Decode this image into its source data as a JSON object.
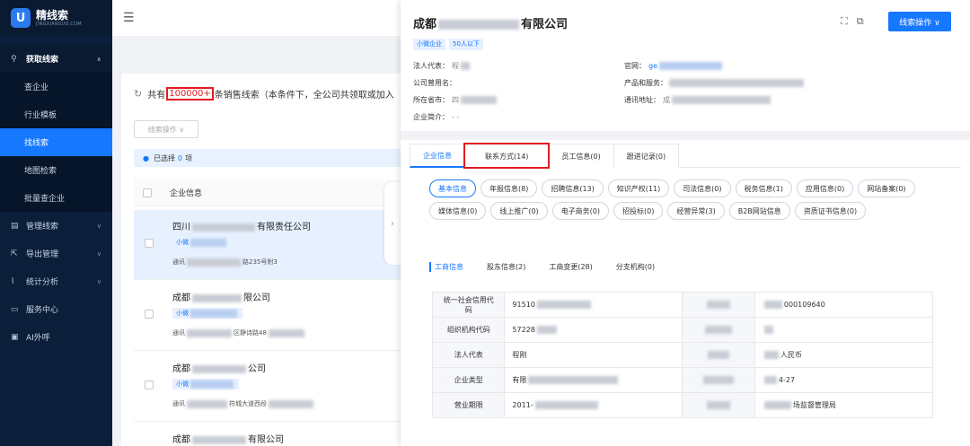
{
  "app": {
    "name": "精线索",
    "sub": "JINGXIANSUO.COM"
  },
  "sidebar": {
    "groups": [
      {
        "label": "获取线索",
        "icon": "search-icon"
      },
      {
        "label": "管理线索",
        "icon": "list-icon"
      },
      {
        "label": "导出管理",
        "icon": "export-icon"
      },
      {
        "label": "统计分析",
        "icon": "chart-icon"
      },
      {
        "label": "服务中心",
        "icon": "service-icon"
      },
      {
        "label": "AI外呼",
        "icon": "phone-icon"
      }
    ],
    "sub_items": [
      "查企业",
      "行业模板",
      "找线索",
      "地图检索",
      "批量查企业"
    ]
  },
  "list": {
    "count_prefix": "共有",
    "count_value": "100000+",
    "count_suffix": "条销售线索（本条件下，全公司共领取或加入",
    "op_button": "线索操作 ∨",
    "selected_prefix": "已选择",
    "selected_count": "0",
    "selected_suffix": "项",
    "column_header": "企业信息",
    "rows": [
      {
        "name_a": "四川",
        "name_b": "有限责任公司",
        "tag": "小微",
        "addr_a": "通讯",
        "addr_b": "路235号附3"
      },
      {
        "name_a": "成都",
        "name_b": "限公司",
        "tag": "小微",
        "addr_a": "通讯",
        "addr_b": "区静诗路48"
      },
      {
        "name_a": "成都",
        "name_b": "公司",
        "tag": "小微",
        "addr_a": "通讯",
        "addr_b": "符城大道西段"
      },
      {
        "name_a": "成都",
        "name_b": "有限公司",
        "tag": "",
        "addr_a": "",
        "addr_b": ""
      }
    ]
  },
  "drawer": {
    "title_a": "成都",
    "title_b": "有限公司",
    "tags": [
      "小微企业",
      "50人以下"
    ],
    "action_button": "线索操作 ∨",
    "fields": {
      "legal_rep": "法人代表：",
      "legal_rep_val": "程",
      "former_name": "公司曾用名：",
      "region": "所在省市：",
      "region_val": "四",
      "intro": "企业简介：",
      "intro_val": "- -",
      "website": "官网：",
      "website_val": "ge",
      "products": "产品和服务：",
      "address": "通讯地址：",
      "address_val": "成"
    },
    "tabs": [
      "企业信息",
      "联系方式(14)",
      "员工信息(0)",
      "跟进记录(0)"
    ],
    "pills": [
      "基本信息",
      "年报信息(8)",
      "招聘信息(13)",
      "知识产权(11)",
      "司法信息(0)",
      "税务信息(1)",
      "应用信息(0)",
      "网站备案(0)",
      "媒体信息(0)",
      "线上推广(0)",
      "电子商务(0)",
      "招投标(0)",
      "经营异常(3)",
      "B2B网站信息",
      "资质证书信息(0)"
    ],
    "subtabs": [
      "工商信息",
      "股东信息(2)",
      "工商变更(28)",
      "分支机构(0)"
    ],
    "table": [
      {
        "label": "统一社会信用代码",
        "value": "91510",
        "value2": "000109640"
      },
      {
        "label": "组织机构代码",
        "value": "57228",
        "value2": ""
      },
      {
        "label": "法人代表",
        "value": "程刚",
        "value2": "人民币"
      },
      {
        "label": "企业类型",
        "value": "有限",
        "value2": "4-27"
      },
      {
        "label": "营业期限",
        "value": "2011-",
        "value2": "场监督管理局"
      }
    ]
  }
}
